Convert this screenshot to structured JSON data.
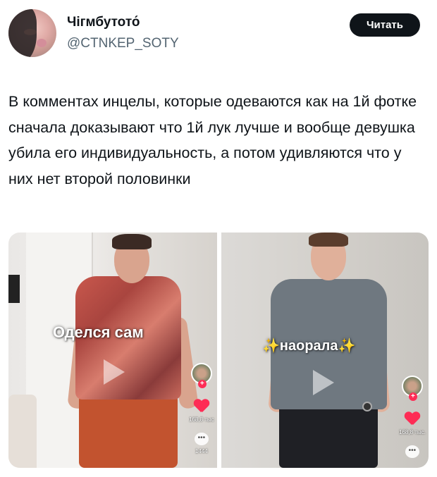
{
  "author": {
    "name": "Чігмбутото́",
    "handle": "@CTNKEP_SOTY"
  },
  "follow_label": "Читать",
  "tweet": {
    "text": "В комментах инцелы, которые одеваются как на 1й фотке сначала доказывают что 1й лук лучше и вообще девушка убила его индивидуальность, а потом удивляются что у них нет второй половинки"
  },
  "media": {
    "left": {
      "caption": "Оделся сам",
      "likes": "168,8 тыс",
      "comments": "1444"
    },
    "right": {
      "caption": "наорала",
      "sparkle": "✨",
      "likes": "168,8 тыс."
    }
  },
  "icons": {
    "play": "play-icon",
    "heart": "heart-icon",
    "comment": "comment-icon",
    "plus": "plus-icon"
  },
  "colors": {
    "follow_bg": "#0f1419",
    "handle": "#536471",
    "like": "#fe2c55"
  }
}
